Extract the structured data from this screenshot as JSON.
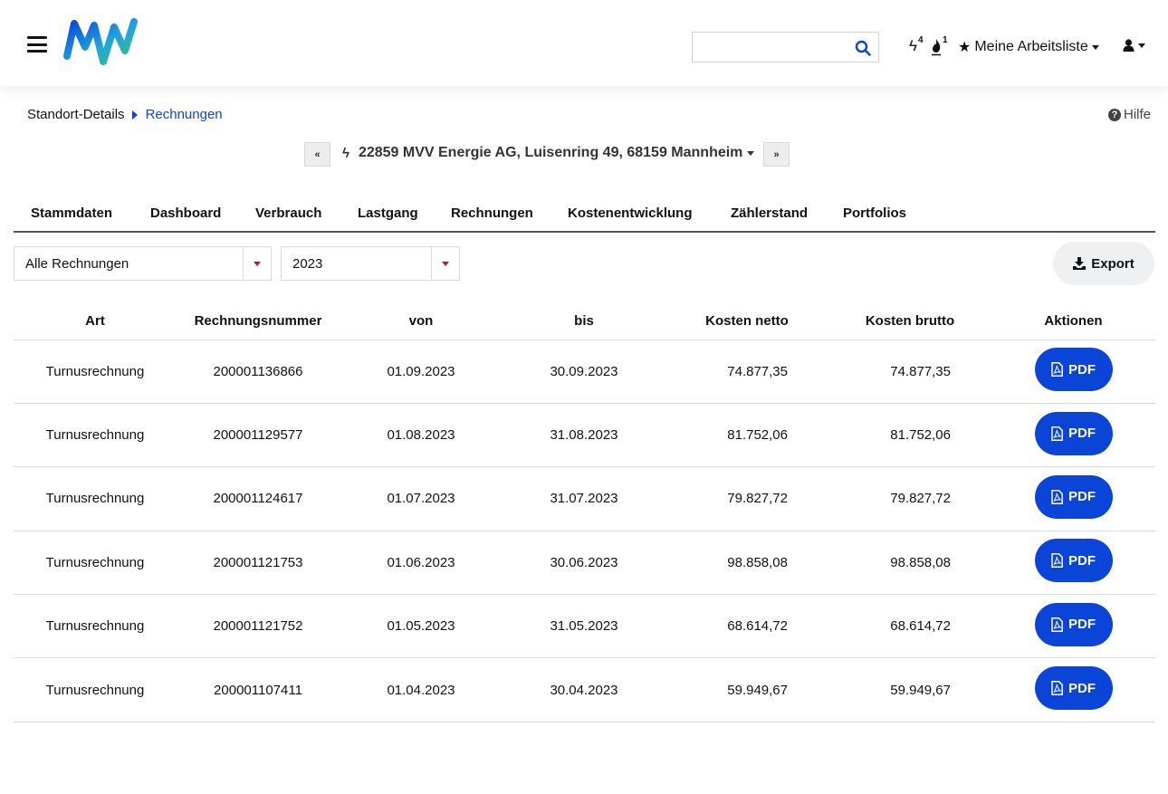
{
  "header": {
    "search": {
      "value": "",
      "placeholder": ""
    },
    "notifications": [
      {
        "icon": "bolt-icon",
        "count": "4"
      },
      {
        "icon": "flame-icon",
        "count": "1"
      }
    ],
    "worklist_label": "Meine Arbeitsliste",
    "user_icon": "user-icon"
  },
  "breadcrumb": {
    "parent": "Standort-Details",
    "current": "Rechnungen"
  },
  "help_label": "Hilfe",
  "location": {
    "label": "22859 MVV Energie AG, Luisenring 49, 68159 Mannheim"
  },
  "tabs": [
    {
      "label": "Stammdaten"
    },
    {
      "label": "Dashboard"
    },
    {
      "label": "Verbrauch"
    },
    {
      "label": "Lastgang"
    },
    {
      "label": "Rechnungen",
      "active": true
    },
    {
      "label": "Kostenentwicklung"
    },
    {
      "label": "Zählerstand"
    },
    {
      "label": "Portfolios"
    }
  ],
  "filters": {
    "type": "Alle Rechnungen",
    "year": "2023"
  },
  "export_label": "Export",
  "table": {
    "columns": [
      "Art",
      "Rechnungsnummer",
      "von",
      "bis",
      "Kosten netto",
      "Kosten brutto",
      "Aktionen"
    ],
    "action_label": "PDF",
    "rows": [
      {
        "art": "Turnusrechnung",
        "nummer": "200001136866",
        "von": "01.09.2023",
        "bis": "30.09.2023",
        "netto": "74.877,35",
        "brutto": "74.877,35"
      },
      {
        "art": "Turnusrechnung",
        "nummer": "200001129577",
        "von": "01.08.2023",
        "bis": "31.08.2023",
        "netto": "81.752,06",
        "brutto": "81.752,06"
      },
      {
        "art": "Turnusrechnung",
        "nummer": "200001124617",
        "von": "01.07.2023",
        "bis": "31.07.2023",
        "netto": "79.827,72",
        "brutto": "79.827,72"
      },
      {
        "art": "Turnusrechnung",
        "nummer": "200001121753",
        "von": "01.06.2023",
        "bis": "30.06.2023",
        "netto": "98.858,08",
        "brutto": "98.858,08"
      },
      {
        "art": "Turnusrechnung",
        "nummer": "200001121752",
        "von": "01.05.2023",
        "bis": "31.05.2023",
        "netto": "68.614,72",
        "brutto": "68.614,72"
      },
      {
        "art": "Turnusrechnung",
        "nummer": "200001107411",
        "von": "01.04.2023",
        "bis": "30.04.2023",
        "netto": "59.949,67",
        "brutto": "59.949,67"
      }
    ]
  },
  "colors": {
    "accent": "#0b45d8",
    "select_arrow": "#c4141b"
  }
}
